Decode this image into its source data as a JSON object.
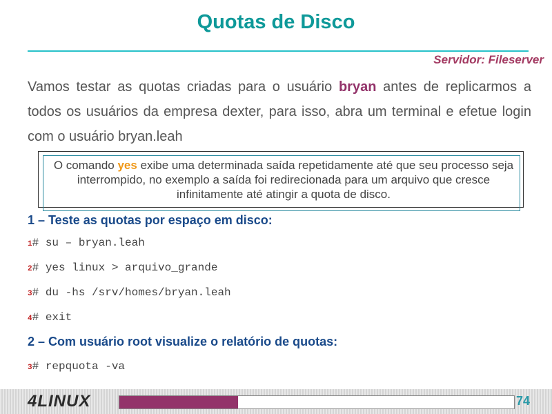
{
  "header": {
    "title": "Quotas de Disco",
    "server": "Servidor: Fileserver"
  },
  "intro": {
    "before": "Vamos testar as quotas criadas para o usuário ",
    "user": "bryan",
    "after": " antes de replicarmos a todos os usuários da empresa dexter, para isso, abra um terminal e efetue login com o usuário bryan.leah"
  },
  "note": {
    "before": "O comando ",
    "command": "yes",
    "after": " exibe uma determinada saída repetidamente até que seu processo seja interrompido, no exemplo a saída foi redirecionada  para um arquivo que cresce infinitamente até atingir a quota de disco."
  },
  "steps": [
    {
      "title": "1 – Teste as quotas por espaço em disco:",
      "commands": [
        {
          "num": "1",
          "text": "# su – bryan.leah"
        },
        {
          "num": "2",
          "text": "# yes linux > arquivo_grande"
        },
        {
          "num": "3",
          "text": "# du -hs /srv/homes/bryan.leah"
        },
        {
          "num": "4",
          "text": "# exit"
        }
      ]
    },
    {
      "title": "2 – Com usuário root visualize o relatório de quotas:",
      "commands": [
        {
          "num": "3",
          "text": "# repquota -va"
        }
      ]
    }
  ],
  "footer": {
    "logo": "4LINUX",
    "page": "74",
    "progress_fraction": 0.3
  },
  "colors": {
    "title": "#0e9999",
    "accent": "#93336a",
    "command_highlight": "#f09818",
    "step_heading": "#1a4a8a"
  }
}
